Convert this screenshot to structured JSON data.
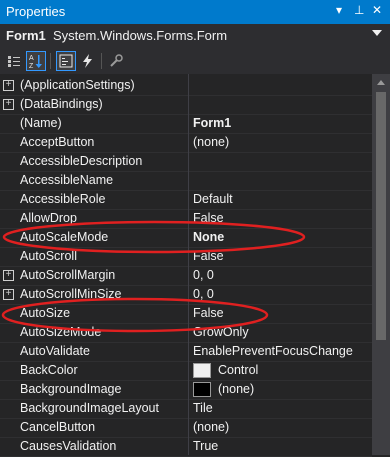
{
  "panel": {
    "title": "Properties",
    "object_name": "Form1",
    "object_type": "System.Windows.Forms.Form"
  },
  "title_icons": [
    "dropdown-arrow-icon",
    "pin-icon",
    "close-icon"
  ],
  "toolbar_icons": [
    "categorized-icon",
    "alphabetical-icon",
    "properties-icon",
    "events-icon",
    "property-pages-icon"
  ],
  "properties": [
    {
      "name": "(ApplicationSettings)",
      "value": "",
      "expandable": true
    },
    {
      "name": "(DataBindings)",
      "value": "",
      "expandable": true
    },
    {
      "name": "(Name)",
      "value": "Form1",
      "bold": true
    },
    {
      "name": "AcceptButton",
      "value": "(none)"
    },
    {
      "name": "AccessibleDescription",
      "value": ""
    },
    {
      "name": "AccessibleName",
      "value": ""
    },
    {
      "name": "AccessibleRole",
      "value": "Default"
    },
    {
      "name": "AllowDrop",
      "value": "False"
    },
    {
      "name": "AutoScaleMode",
      "value": "None",
      "bold": true,
      "highlighted": true
    },
    {
      "name": "AutoScroll",
      "value": "False"
    },
    {
      "name": "AutoScrollMargin",
      "value": "0, 0",
      "expandable": true
    },
    {
      "name": "AutoScrollMinSize",
      "value": "0, 0",
      "expandable": true
    },
    {
      "name": "AutoSize",
      "value": "False",
      "highlighted": true
    },
    {
      "name": "AutoSizeMode",
      "value": "GrowOnly"
    },
    {
      "name": "AutoValidate",
      "value": "EnablePreventFocusChange"
    },
    {
      "name": "BackColor",
      "value": "Control",
      "swatch": "#f0f0f0"
    },
    {
      "name": "BackgroundImage",
      "value": "(none)",
      "swatch": "#000000"
    },
    {
      "name": "BackgroundImageLayout",
      "value": "Tile"
    },
    {
      "name": "CancelButton",
      "value": "(none)"
    },
    {
      "name": "CausesValidation",
      "value": "True"
    }
  ],
  "colors": {
    "accent": "#007acc",
    "annotation": "#e02020"
  }
}
